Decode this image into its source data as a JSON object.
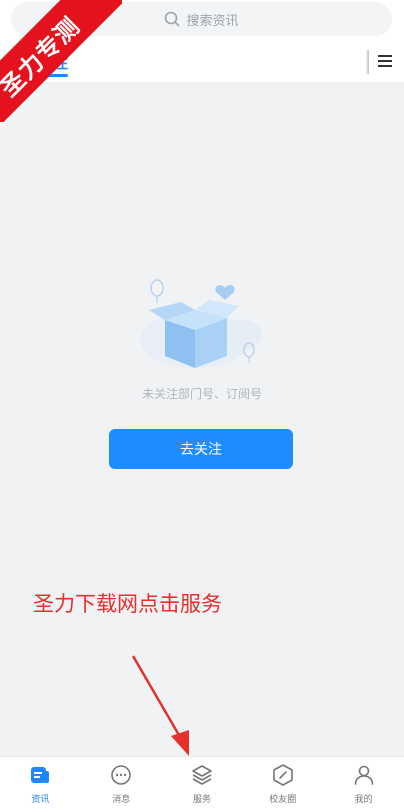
{
  "search": {
    "placeholder": "搜索资讯"
  },
  "tabs": {
    "active_label": "关注"
  },
  "badge": {
    "text": "圣力专测"
  },
  "empty_state": {
    "message": "未关注部门号、订阅号",
    "button_label": "去关注"
  },
  "annotation": {
    "text": "圣力下载网点击服务"
  },
  "bottom_nav": {
    "items": [
      {
        "label": "资讯",
        "icon": "news-icon",
        "active": true
      },
      {
        "label": "消息",
        "icon": "chat-icon",
        "active": false
      },
      {
        "label": "服务",
        "icon": "layers-icon",
        "active": false
      },
      {
        "label": "校友圈",
        "icon": "compass-icon",
        "active": false
      },
      {
        "label": "我的",
        "icon": "user-icon",
        "active": false
      }
    ]
  },
  "colors": {
    "accent": "#1e88ff",
    "annotation": "#e5302c",
    "badge": "#e4121d"
  }
}
